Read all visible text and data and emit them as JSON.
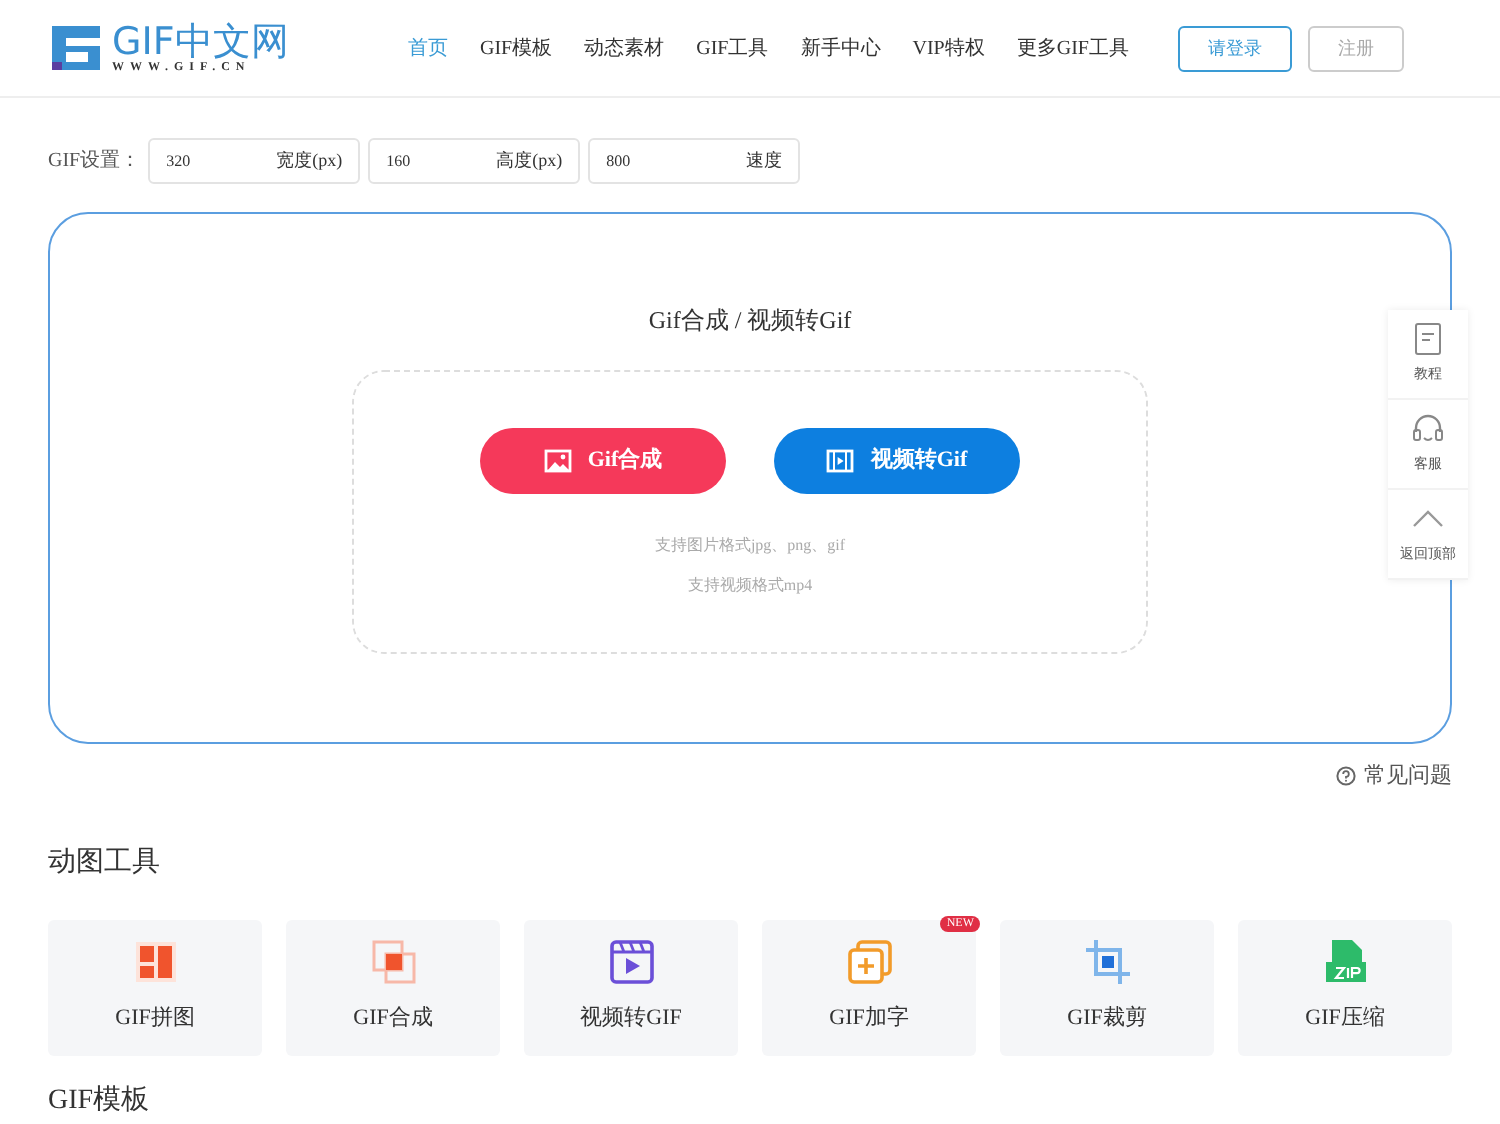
{
  "logo": {
    "name": "GIF中文网",
    "url": "WWW.GIF.CN"
  },
  "nav": [
    {
      "label": "首页",
      "selected": true
    },
    {
      "label": "GIF模板",
      "selected": false
    },
    {
      "label": "动态素材",
      "selected": false
    },
    {
      "label": "GIF工具",
      "selected": false
    },
    {
      "label": "新手中心",
      "selected": false
    },
    {
      "label": "VIP特权",
      "selected": false
    },
    {
      "label": "更多GIF工具",
      "selected": false
    }
  ],
  "auth": [
    {
      "label": "请登录",
      "kind": "primary"
    },
    {
      "label": "注册",
      "kind": "secondary"
    }
  ],
  "settings": {
    "label": "GIF设置：",
    "fields": [
      {
        "value": "320",
        "unit": "宽度(px)"
      },
      {
        "value": "160",
        "unit": "高度(px)"
      },
      {
        "value": "800",
        "unit": "速度"
      }
    ]
  },
  "upload": {
    "title": "Gif合成 / 视频转Gif",
    "buttons": [
      {
        "label": "Gif合成",
        "kind": "image"
      },
      {
        "label": "视频转Gif",
        "kind": "video"
      }
    ],
    "hints": [
      "支持图片格式jpg、png、gif",
      "支持视频格式mp4"
    ]
  },
  "side_tools": [
    {
      "label": "教程",
      "kind": "doc"
    },
    {
      "label": "客服",
      "kind": "headset"
    },
    {
      "label": "返回顶部",
      "kind": "top"
    }
  ],
  "faq": "常见问题",
  "tools_title": "动图工具",
  "tools": [
    {
      "label": "GIF拼图",
      "kind": "collage"
    },
    {
      "label": "GIF合成",
      "kind": "merge"
    },
    {
      "label": "视频转GIF",
      "kind": "video"
    },
    {
      "label": "GIF加字",
      "kind": "text",
      "badge": "NEW"
    },
    {
      "label": "GIF裁剪",
      "kind": "crop"
    },
    {
      "label": "GIF压缩",
      "kind": "zip"
    }
  ],
  "templates_title": "GIF模板"
}
